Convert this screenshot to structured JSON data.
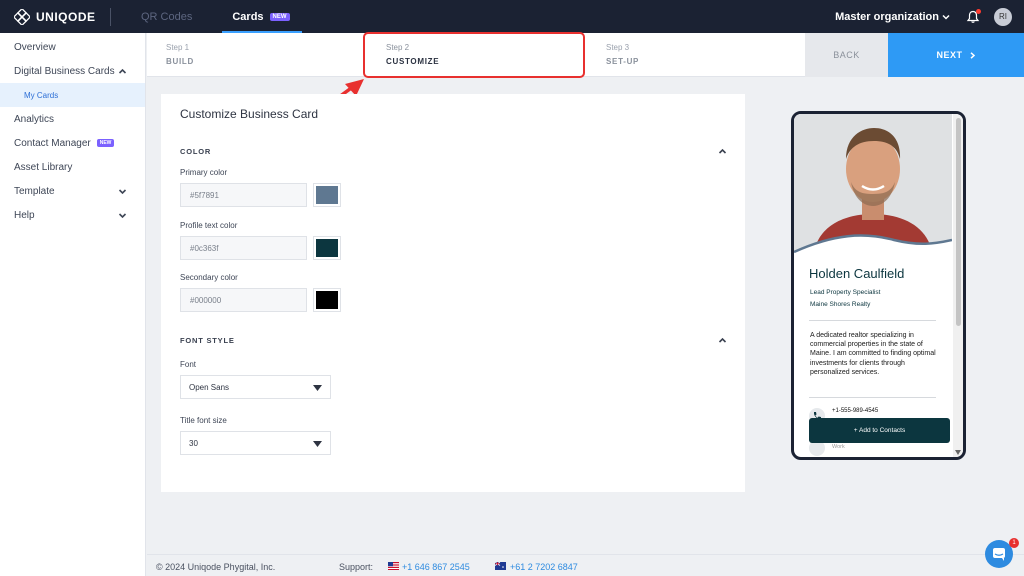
{
  "brand": {
    "name": "UNIQODE"
  },
  "topnav": {
    "items": [
      {
        "label": "QR Codes"
      },
      {
        "label": "Cards",
        "badge": "NEW"
      }
    ],
    "org": "Master organization",
    "avatar_initials": "RI"
  },
  "sidebar": {
    "items": [
      {
        "label": "Overview"
      },
      {
        "label": "Digital Business Cards"
      },
      {
        "label": "My Cards"
      },
      {
        "label": "Analytics"
      },
      {
        "label": "Contact Manager",
        "badge": "NEW"
      },
      {
        "label": "Asset Library"
      },
      {
        "label": "Template"
      },
      {
        "label": "Help"
      }
    ]
  },
  "stepper": {
    "steps": [
      {
        "num": "Step 1",
        "name": "BUILD"
      },
      {
        "num": "Step 2",
        "name": "CUSTOMIZE"
      },
      {
        "num": "Step 3",
        "name": "SET-UP"
      }
    ],
    "back_label": "BACK",
    "next_label": "NEXT"
  },
  "form": {
    "title": "Customize Business Card",
    "color_section": "COLOR",
    "primary_label": "Primary color",
    "primary_value": "#5f7891",
    "profile_label": "Profile text color",
    "profile_value": "#0c363f",
    "secondary_label": "Secondary color",
    "secondary_value": "#000000",
    "font_section": "FONT STYLE",
    "font_label": "Font",
    "font_value": "Open Sans",
    "size_label": "Title font size",
    "size_value": "30"
  },
  "card": {
    "name": "Holden Caulfield",
    "role": "Lead Property Specialist",
    "company": "Maine Shores Realty",
    "bio": "A dedicated realtor specializing in commercial properties in the state of Maine. I am committed to finding optimal investments for clients through personalized services.",
    "phone": "+1-555-989-4545",
    "work_label": "Work",
    "add_button": "+ Add to Contacts"
  },
  "footer": {
    "copyright": "© 2024 Uniqode Phygital, Inc.",
    "support_label": "Support:",
    "phone_us": "+1 646 867 2545",
    "phone_au": "+61 2 7202 6847"
  },
  "chat": {
    "badge": "1"
  },
  "colors": {
    "accent": "#2e9af5",
    "topbar": "#1b2233",
    "highlight": "#e8302f",
    "primary_swatch": "#5f7891",
    "profile_swatch": "#0c363f",
    "secondary_swatch": "#000000"
  }
}
